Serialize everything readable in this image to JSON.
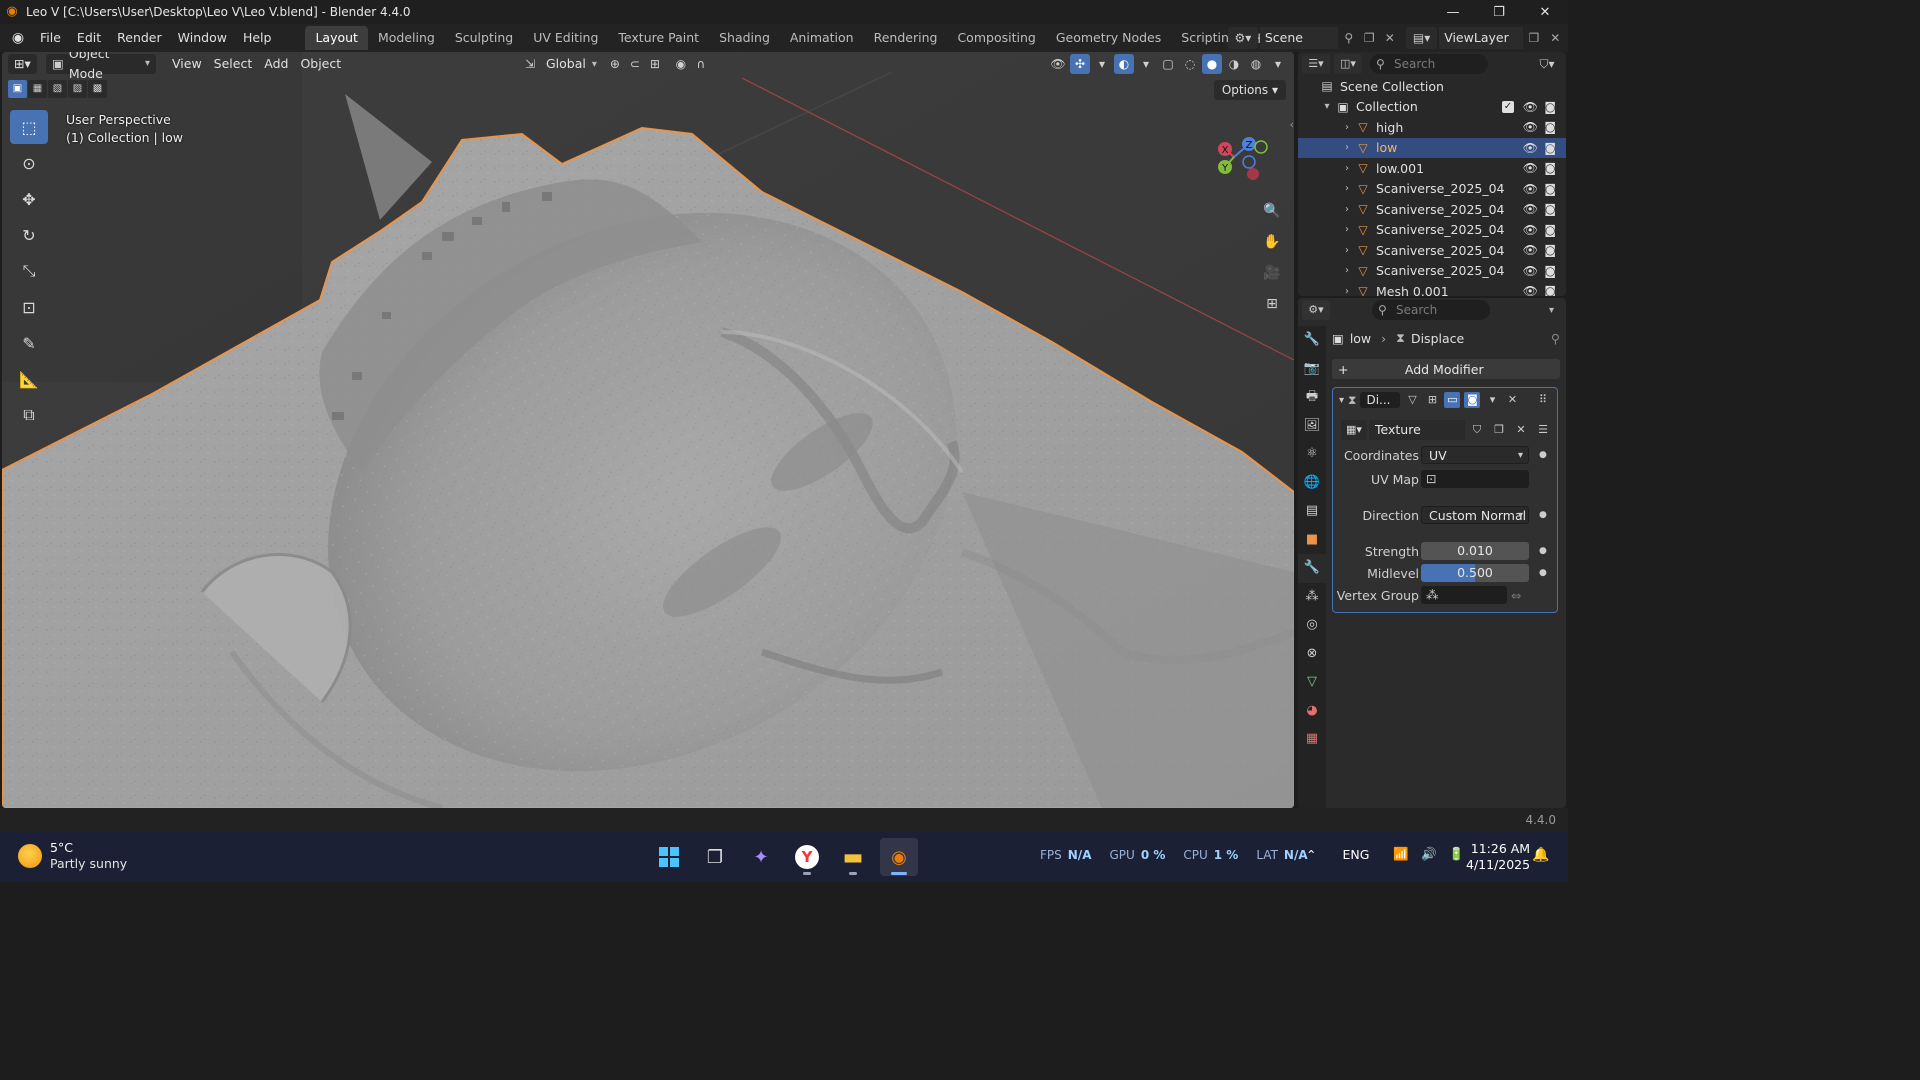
{
  "window": {
    "title": "Leo V [C:\\Users\\User\\Desktop\\Leo V\\Leo V.blend] - Blender 4.4.0",
    "controls": [
      "minimize",
      "maximize",
      "close"
    ]
  },
  "menubar": {
    "items": [
      "File",
      "Edit",
      "Render",
      "Window",
      "Help"
    ],
    "workspaces": [
      "Layout",
      "Modeling",
      "Sculpting",
      "UV Editing",
      "Texture Paint",
      "Shading",
      "Animation",
      "Rendering",
      "Compositing",
      "Geometry Nodes",
      "Scripting"
    ],
    "active_workspace": "Layout",
    "scene": "Scene",
    "view_layer": "ViewLayer"
  },
  "viewport": {
    "mode": "Object Mode",
    "menus": [
      "View",
      "Select",
      "Add",
      "Object"
    ],
    "transform_orientation": "Global",
    "options_label": "Options",
    "info_line1": "User Perspective",
    "info_line2": "(1) Collection | low",
    "gizmo_axes": [
      "X",
      "Y",
      "Z"
    ]
  },
  "outliner": {
    "search_placeholder": "Search",
    "scene_collection": "Scene Collection",
    "collection": "Collection",
    "objects": [
      {
        "name": "high",
        "selected": false
      },
      {
        "name": "low",
        "selected": true
      },
      {
        "name": "low.001",
        "selected": false
      },
      {
        "name": "Scaniverse_2025_04",
        "selected": false
      },
      {
        "name": "Scaniverse_2025_04",
        "selected": false
      },
      {
        "name": "Scaniverse_2025_04",
        "selected": false
      },
      {
        "name": "Scaniverse_2025_04",
        "selected": false
      },
      {
        "name": "Scaniverse_2025_04",
        "selected": false
      },
      {
        "name": "Mesh 0.001",
        "selected": false
      }
    ]
  },
  "properties": {
    "search_placeholder": "Search",
    "breadcrumb_object": "low",
    "breadcrumb_modifier": "Displace",
    "add_modifier_label": "Add Modifier",
    "modifier": {
      "name": "Di...",
      "texture": "Texture",
      "coordinates_label": "Coordinates",
      "coordinates_value": "UV",
      "uv_map_label": "UV Map",
      "direction_label": "Direction",
      "direction_value": "Custom Normal",
      "strength_label": "Strength",
      "strength_value": "0.010",
      "midlevel_label": "Midlevel",
      "midlevel_value": "0.500",
      "vertex_group_label": "Vertex Group"
    }
  },
  "statusbar": {
    "version": "4.4.0"
  },
  "taskbar": {
    "weather_temp": "5°C",
    "weather_desc": "Partly sunny",
    "stats": [
      {
        "label": "FPS",
        "value": "N/A"
      },
      {
        "label": "GPU",
        "value": "0 %"
      },
      {
        "label": "CPU",
        "value": "1 %"
      },
      {
        "label": "LAT",
        "value": "N/A"
      }
    ],
    "language": "ENG",
    "time": "11:26 AM",
    "date": "4/11/2025"
  },
  "colors": {
    "accent": "#4772b3",
    "selection_outline": "#e8944a",
    "viewport_bg": "#3a3a3a"
  }
}
